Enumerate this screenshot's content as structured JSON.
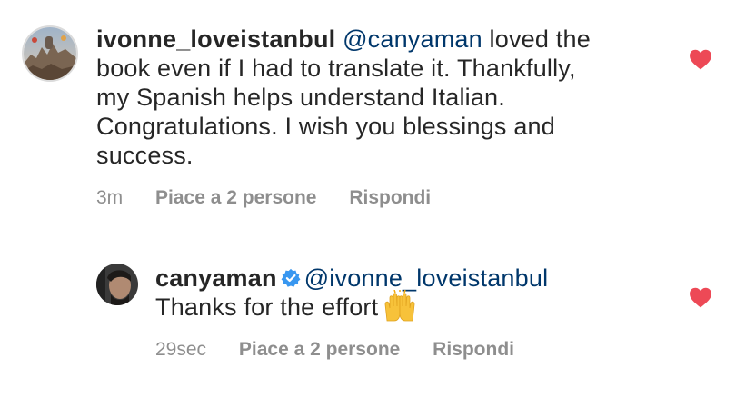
{
  "comment": {
    "username": "ivonne_loveistanbul",
    "mention": "@canyaman",
    "text_line1": " loved the",
    "text_lines": [
      "book even if I had to translate it.  Thankfully,",
      "my Spanish helps understand Italian.",
      "Congratulations.  I wish you blessings and",
      "success."
    ],
    "time": "3m",
    "likes": "Piace a 2 persone",
    "reply": "Rispondi",
    "liked": true
  },
  "reply_comment": {
    "username": "canyaman",
    "verified": true,
    "mention": "@ivonne_loveistanbul",
    "text": "Thanks for the effort",
    "emoji": "raising-hands-emoji",
    "time": "29sec",
    "likes": "Piace a 2 persone",
    "reply": "Rispondi",
    "liked": true
  },
  "colors": {
    "mention": "#00376b",
    "heart": "#ed4956",
    "verified": "#3897f0",
    "meta": "#8e8e8e"
  }
}
